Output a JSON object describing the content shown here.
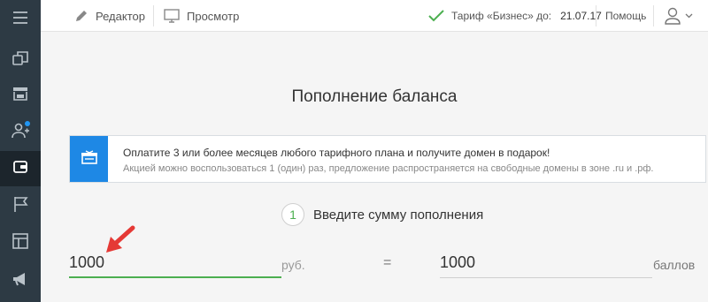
{
  "colors": {
    "sidebar_bg": "#2d3a44",
    "sidebar_active_bg": "#1c252c",
    "accent_blue": "#1e88e5",
    "accent_green": "#4caf50",
    "annotation_red": "#e53935"
  },
  "sidebar": {
    "items": [
      {
        "icon": "menu-icon"
      },
      {
        "icon": "pages-icon"
      },
      {
        "icon": "shop-icon"
      },
      {
        "icon": "users-icon",
        "has_notification": true
      },
      {
        "icon": "wallet-icon",
        "active": true
      },
      {
        "icon": "flag-icon"
      },
      {
        "icon": "layout-icon"
      },
      {
        "icon": "megaphone-icon"
      }
    ]
  },
  "topbar": {
    "editor_label": "Редактор",
    "preview_label": "Просмотр",
    "tariff_label": "Тариф «Бизнес» до:",
    "tariff_date": "21.07.17",
    "help_label": "Помощь"
  },
  "main": {
    "title": "Пополнение баланса",
    "promo": {
      "line1": "Оплатите 3 или более месяцев любого тарифного плана и получите домен в подарок!",
      "line2": "Акцией можно воспользоваться 1 (один) раз, предложение распространяется на свободные домены в зоне .ru и .рф."
    },
    "step": {
      "number": "1",
      "label": "Введите сумму пополнения"
    },
    "amount": {
      "value": "1000",
      "unit": "руб."
    },
    "equals": "=",
    "points": {
      "value": "1000",
      "unit": "баллов"
    }
  }
}
